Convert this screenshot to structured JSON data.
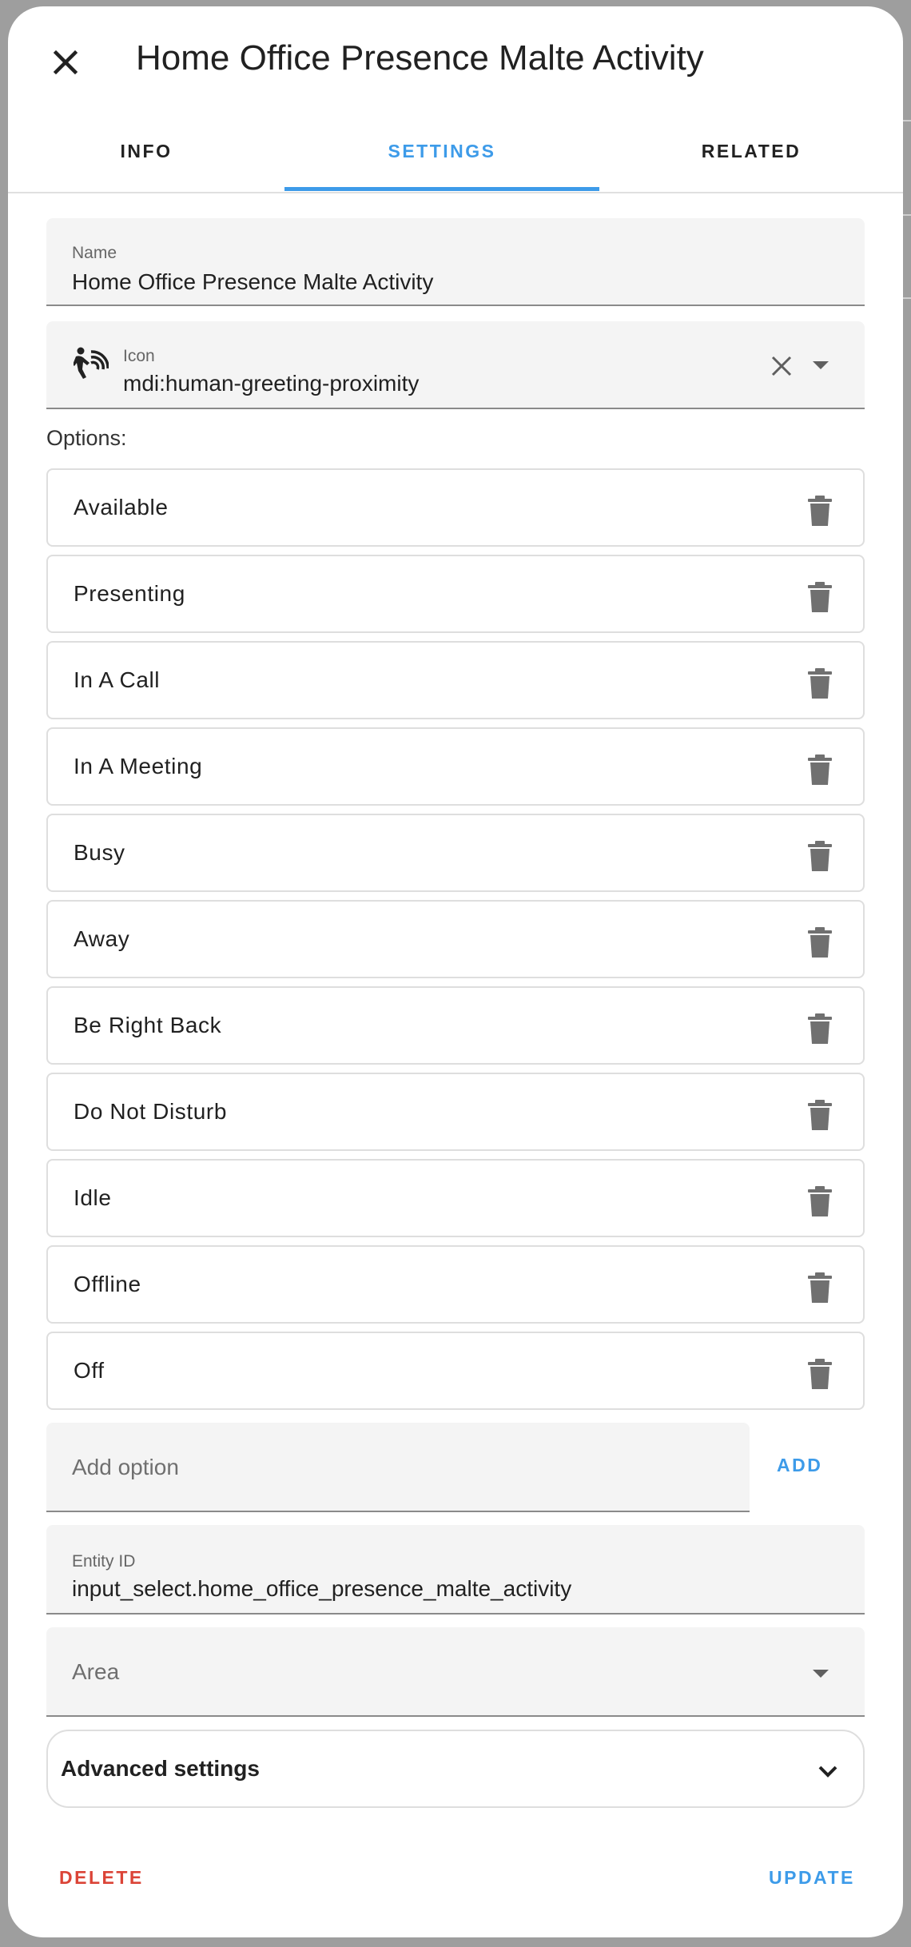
{
  "dialog": {
    "title": "Home Office Presence Malte Activity",
    "close_icon": "close-icon"
  },
  "tabs": [
    {
      "label": "INFO",
      "active": false
    },
    {
      "label": "SETTINGS",
      "active": true
    },
    {
      "label": "RELATED",
      "active": false
    }
  ],
  "name_field": {
    "label": "Name",
    "value": "Home Office Presence Malte Activity"
  },
  "icon_field": {
    "label": "Icon",
    "value": "mdi:human-greeting-proximity",
    "icon": "human-greeting-proximity-icon"
  },
  "options_label": "Options:",
  "options": [
    {
      "label": "Available"
    },
    {
      "label": "Presenting"
    },
    {
      "label": "In A Call"
    },
    {
      "label": "In A Meeting"
    },
    {
      "label": "Busy"
    },
    {
      "label": "Away"
    },
    {
      "label": "Be Right Back"
    },
    {
      "label": "Do Not Disturb"
    },
    {
      "label": "Idle"
    },
    {
      "label": "Offline"
    },
    {
      "label": "Off"
    }
  ],
  "add_option": {
    "placeholder": "Add option",
    "button_label": "ADD"
  },
  "entity_field": {
    "label": "Entity ID",
    "value": "input_select.home_office_presence_malte_activity"
  },
  "area_field": {
    "placeholder": "Area"
  },
  "advanced": {
    "label": "Advanced settings"
  },
  "actions": {
    "delete_label": "DELETE",
    "update_label": "UPDATE"
  },
  "colors": {
    "accent": "#3d9be9",
    "danger": "#db4437",
    "field_bg": "#f4f4f4"
  }
}
